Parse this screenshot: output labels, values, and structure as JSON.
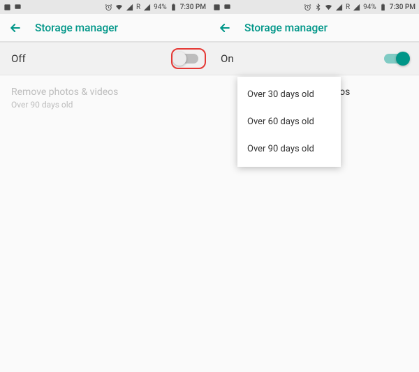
{
  "status": {
    "roaming": "R",
    "battery": "94%",
    "time": "7:30 PM"
  },
  "appbar_title": "Storage manager",
  "left": {
    "toggle_label": "Off",
    "setting_title": "Remove photos & videos",
    "setting_subtitle": "Over 90 days old"
  },
  "right": {
    "toggle_label": "On",
    "behind_text": "Remove photos & videos",
    "dropdown": {
      "opt1": "Over 30 days old",
      "opt2": "Over 60 days old",
      "opt3": "Over 90 days old"
    }
  }
}
